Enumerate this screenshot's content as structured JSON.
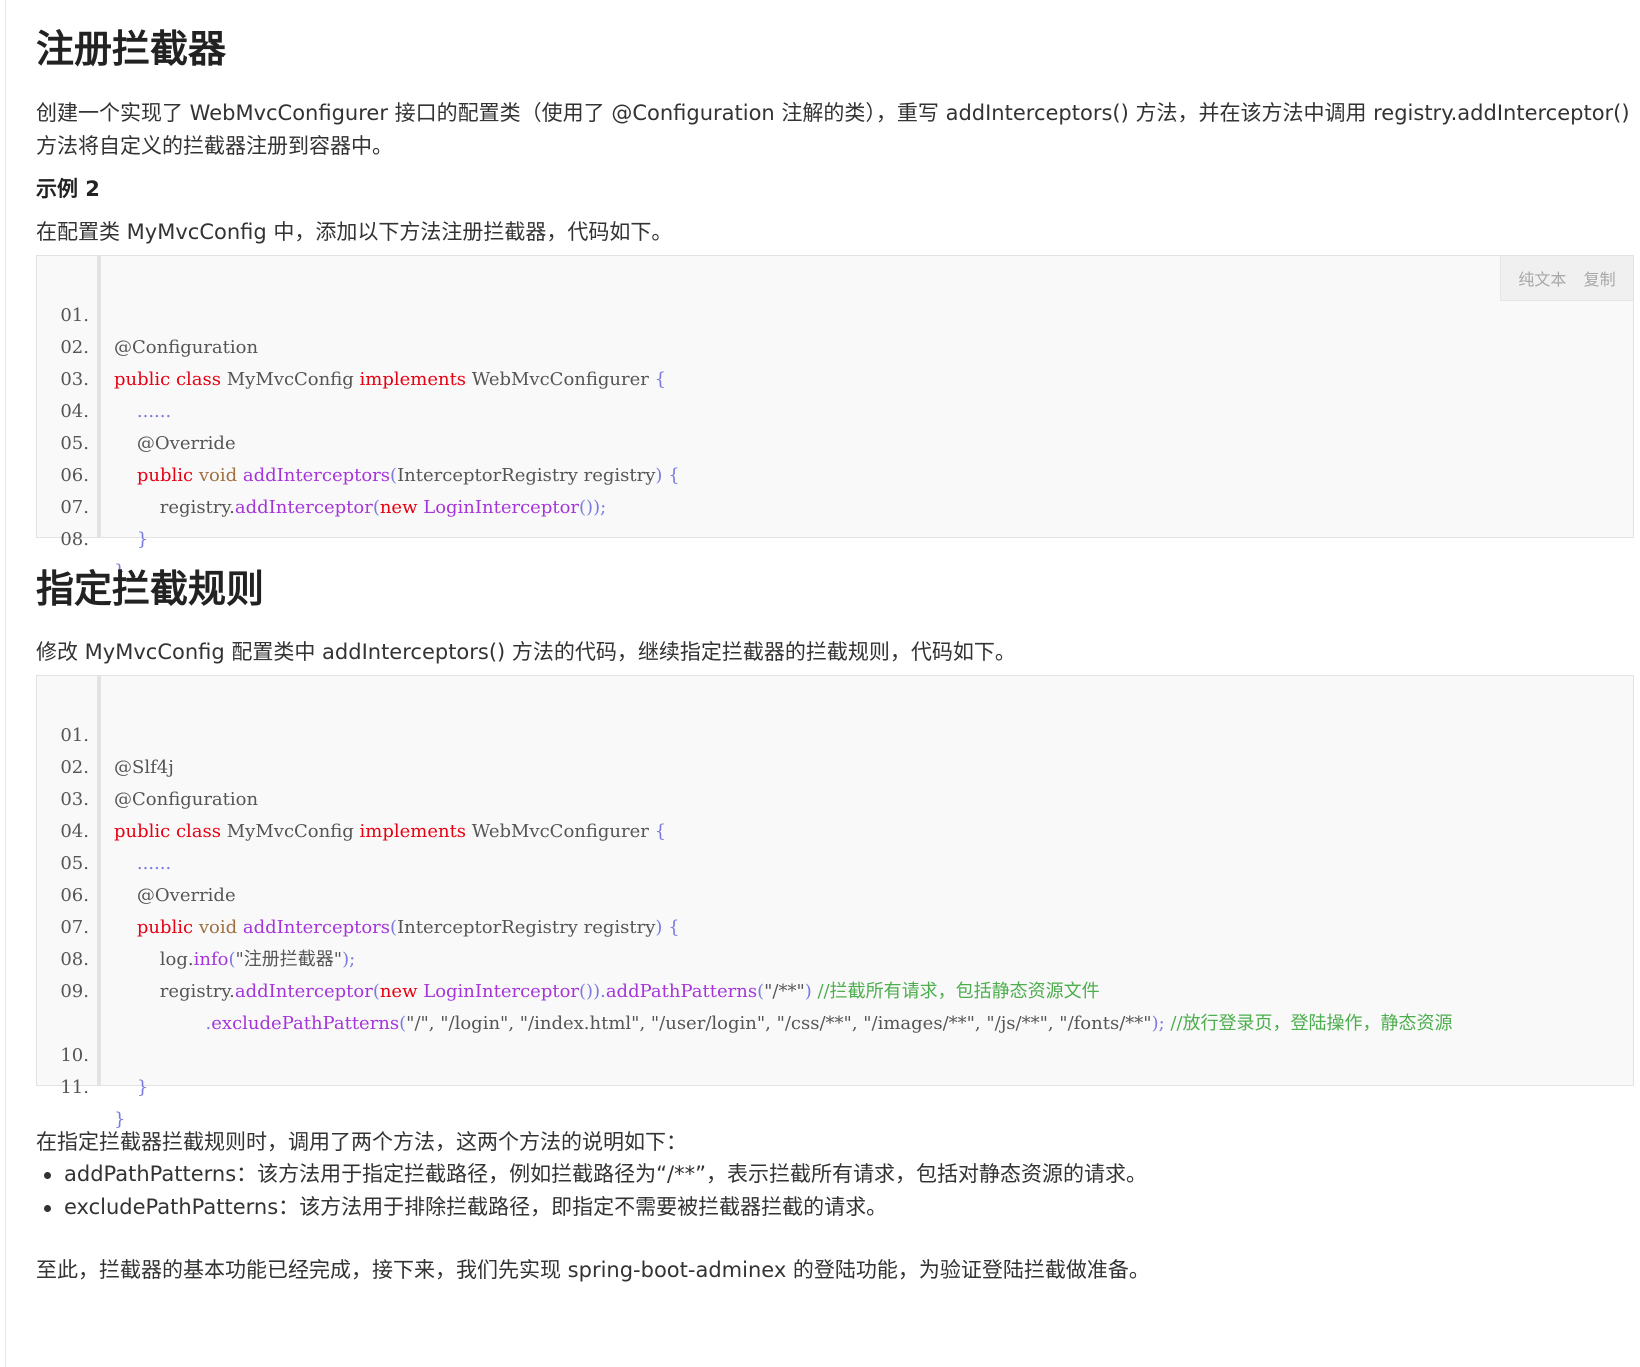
{
  "section1": {
    "heading": "注册拦截器",
    "intro": "创建一个实现了 WebMvcConfigurer 接口的配置类（使用了 @Configuration 注解的类），重写 addInterceptors() 方法，并在该方法中调用 registry.addInterceptor() 方法将自定义的拦截器注册到容器中。",
    "example_label": "示例 2",
    "example_desc": "在配置类 MyMvcConfig 中，添加以下方法注册拦截器，代码如下。",
    "code": {
      "toolbar": {
        "plain_text": "纯文本",
        "copy": "复制"
      },
      "line_numbers": [
        "01.",
        "02.",
        "03.",
        "04.",
        "05.",
        "06.",
        "07.",
        "08."
      ],
      "l1": "@Configuration",
      "l2": {
        "kw1": "public",
        "kw2": "class",
        "name": "MyMvcConfig",
        "kw3": "implements",
        "iface": "WebMvcConfigurer",
        "brace": "{"
      },
      "l3": "......",
      "l4": "@Override",
      "l5": {
        "kw": "public",
        "type": "void",
        "fn": "addInterceptors",
        "open": "(",
        "params": "InterceptorRegistry registry",
        "close": ")",
        "brace": "{"
      },
      "l6": {
        "obj": "registry.",
        "fn": "addInterceptor",
        "open": "(",
        "kw": "new",
        "cls": "LoginInterceptor",
        "tail": "());"
      },
      "l7": "}",
      "l8": "}"
    }
  },
  "section2": {
    "heading": "指定拦截规则",
    "intro": "修改 MyMvcConfig 配置类中 addInterceptors() 方法的代码，继续指定拦截器的拦截规则，代码如下。",
    "code": {
      "line_numbers": [
        "01.",
        "02.",
        "03.",
        "04.",
        "05.",
        "06.",
        "07.",
        "08.",
        "09.",
        "10.",
        "11."
      ],
      "l1": "@Slf4j",
      "l2": "@Configuration",
      "l3": {
        "kw1": "public",
        "kw2": "class",
        "name": "MyMvcConfig",
        "kw3": "implements",
        "iface": "WebMvcConfigurer",
        "brace": "{"
      },
      "l4": "......",
      "l5": "@Override",
      "l6": {
        "kw": "public",
        "type": "void",
        "fn": "addInterceptors",
        "open": "(",
        "params": "InterceptorRegistry registry",
        "close": ")",
        "brace": "{"
      },
      "l7": {
        "obj": "log.",
        "fn": "info",
        "open": "(",
        "str": "\"注册拦截器\"",
        "tail": ");"
      },
      "l8": {
        "obj": "registry.",
        "fn": "addInterceptor",
        "open": "(",
        "kw": "new",
        "cls": "LoginInterceptor",
        "mid": "()).",
        "fn2": "addPathPatterns",
        "open2": "(",
        "str": "\"/**\"",
        "close": ")",
        "comment": "//拦截所有请求，包括静态资源文件"
      },
      "l9": {
        "dot": ".",
        "fn": "excludePathPatterns",
        "open": "(",
        "args": "\"/\", \"/login\", \"/index.html\", \"/user/login\", \"/css/**\", \"/images/**\", \"/js/**\", \"/fonts/**\"",
        "close": ");",
        "comment": "//放行登录页，登陆操作，静态资源"
      },
      "l10": "}",
      "l11": "}"
    }
  },
  "notes": {
    "lead": "在指定拦截器拦截规则时，调用了两个方法，这两个方法的说明如下：",
    "items": [
      "addPathPatterns：该方法用于指定拦截路径，例如拦截路径为“/**”，表示拦截所有请求，包括对静态资源的请求。",
      "excludePathPatterns：该方法用于排除拦截路径，即指定不需要被拦截器拦截的请求。"
    ],
    "closing": "至此，拦截器的基本功能已经完成，接下来，我们先实现 spring-boot-adminex 的登陆功能，为验证登陆拦截做准备。"
  },
  "colors": {
    "keyword": "#e60012",
    "function": "#a535d8",
    "comment": "#4cae4c",
    "bracket": "#7a7adf"
  }
}
